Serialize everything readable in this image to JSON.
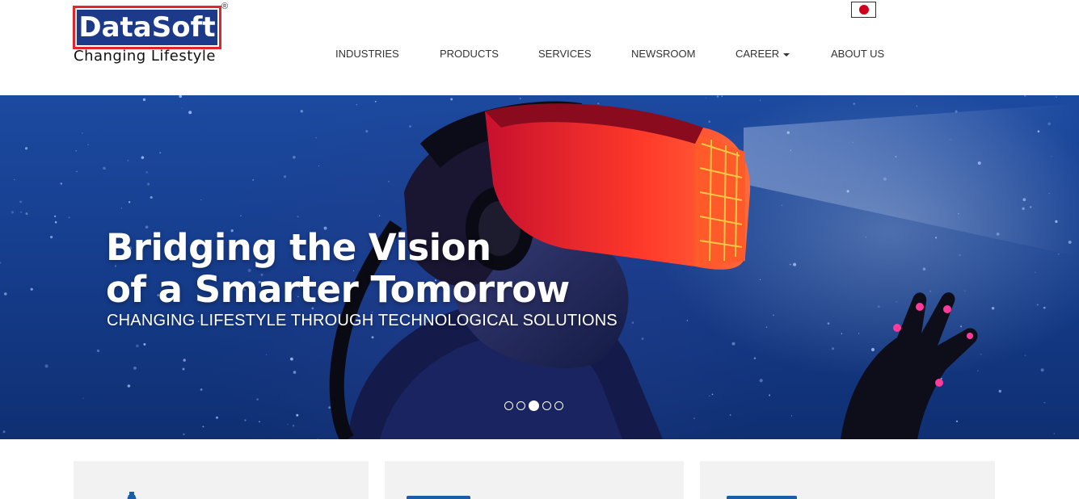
{
  "brand": {
    "name": "DataSoft",
    "registered_mark": "®",
    "tagline": "Changing Lifestyle",
    "colors": {
      "primary": "#1d3a8a",
      "accent": "#e0262c"
    }
  },
  "language_flag": {
    "icon": "japan-flag-icon",
    "color": "#d0021b"
  },
  "nav": {
    "items": [
      {
        "label": "INDUSTRIES"
      },
      {
        "label": "PRODUCTS"
      },
      {
        "label": "SERVICES"
      },
      {
        "label": "NEWSROOM"
      },
      {
        "label": "CAREER",
        "has_dropdown": true
      },
      {
        "label": "ABOUT US"
      }
    ]
  },
  "hero": {
    "title_line1": "Bridging the Vision",
    "title_line2": "of a Smarter Tomorrow",
    "subtitle": "CHANGING LIFESTYLE THROUGH TECHNOLOGICAL SOLUTIONS",
    "slides_total": 5,
    "active_slide": 3
  },
  "cards": {
    "icons": [
      "gear-icon",
      "bar-icon",
      "bar-icon"
    ],
    "accent": "#1a5ea8"
  }
}
